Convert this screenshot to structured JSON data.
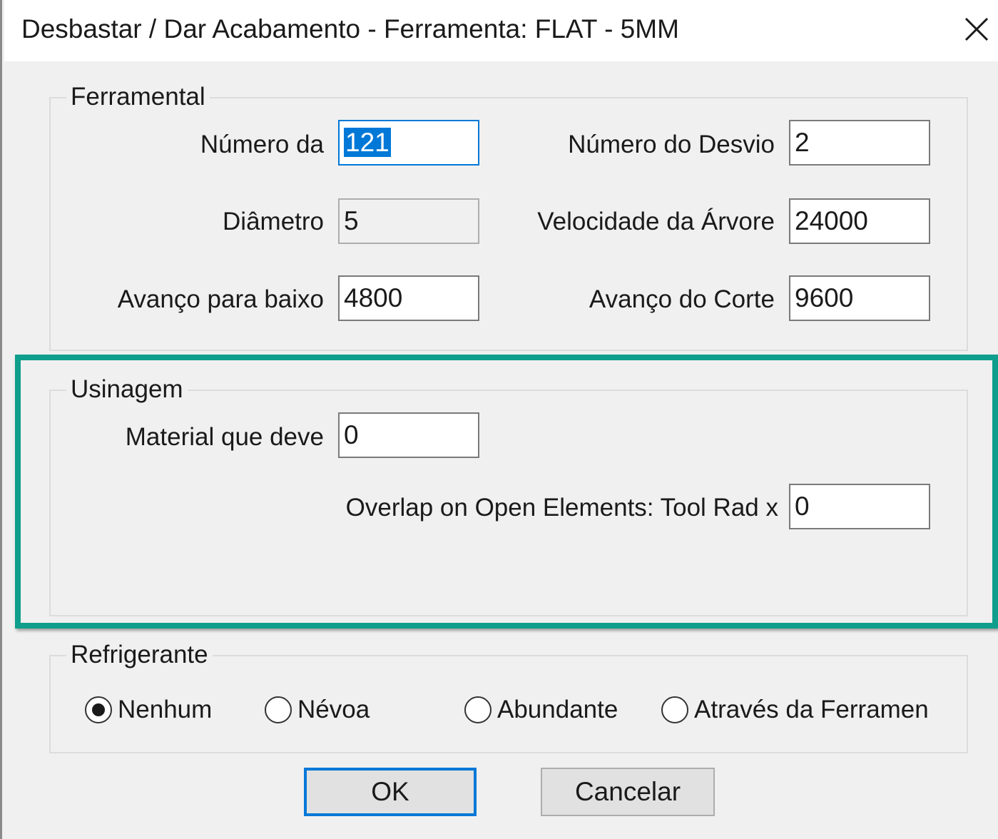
{
  "window": {
    "title": "Desbastar / Dar Acabamento - Ferramenta: FLAT - 5MM",
    "close_icon": "close-icon"
  },
  "ferramental": {
    "group_label": "Ferramental",
    "numero_da_label": "Número da",
    "numero_da_value": "121",
    "numero_desvio_label": "Número do Desvio",
    "numero_desvio_value": "2",
    "diametro_label": "Diâmetro",
    "diametro_value": "5",
    "velocidade_label": "Velocidade da Árvore",
    "velocidade_value": "24000",
    "avanco_baixo_label": "Avanço para baixo",
    "avanco_baixo_value": "4800",
    "avanco_corte_label": "Avanço do Corte",
    "avanco_corte_value": "9600"
  },
  "usinagem": {
    "group_label": "Usinagem",
    "material_label": "Material que deve",
    "material_value": "0",
    "overlap_label": "Overlap on Open Elements: Tool Rad x",
    "overlap_value": "0"
  },
  "refrigerante": {
    "group_label": "Refrigerante",
    "options": [
      {
        "label": "Nenhum",
        "selected": true
      },
      {
        "label": "Névoa",
        "selected": false
      },
      {
        "label": "Abundante",
        "selected": false
      },
      {
        "label": "Através da Ferramen",
        "selected": false
      }
    ]
  },
  "buttons": {
    "ok_label": "OK",
    "cancel_label": "Cancelar"
  },
  "colors": {
    "highlight": "#0f9e8c",
    "focus": "#0078d7",
    "dialog_bg": "#f0f0f0"
  }
}
